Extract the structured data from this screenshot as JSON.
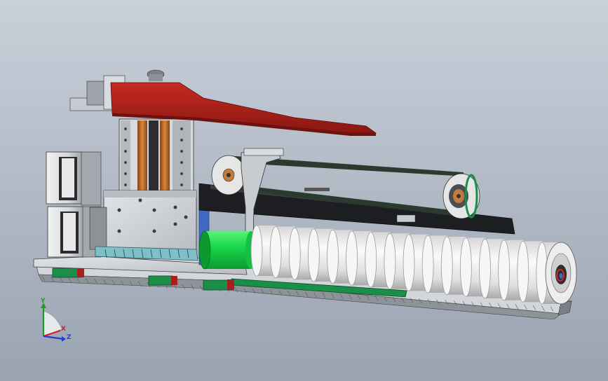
{
  "scene": {
    "background_top": "#c9d0da",
    "background_bottom": "#9aa3b1",
    "colors": {
      "arm": "#b3221a",
      "arm_shade": "#7e1510",
      "green_roller": "#19d84c",
      "green_roller_shade": "#0c9a30",
      "green_rail": "#1b8e49",
      "rail_red": "#a7201d",
      "roll_light": "#f4f4f4",
      "roll_shade": "#b9b9b9",
      "copper": "#c46a2a",
      "metal": "#c8ccd1",
      "metal_dark": "#6b7079",
      "black_bar": "#1c1e22",
      "teal": "#7fbfc7"
    },
    "roll_segments": 16
  },
  "triad": {
    "y_label": "Y",
    "x_label": "X",
    "z_label": "Z",
    "x_color": "#d21f1f",
    "y_color": "#1e9c2a",
    "z_color": "#1f3fd2"
  }
}
